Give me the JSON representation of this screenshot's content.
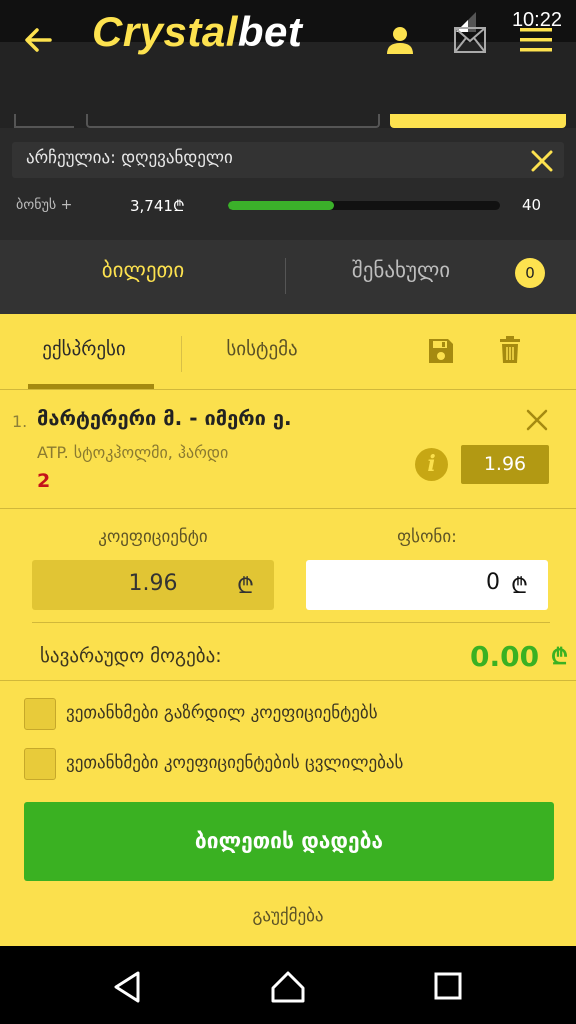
{
  "status_bar": {
    "time": "10:22"
  },
  "header": {
    "logo_part1": "Crystal",
    "logo_part2": "bet"
  },
  "filter": {
    "text": "არჩეულია:  დღევანდელი"
  },
  "bonus": {
    "label": "ბონუს +",
    "amount": "3,741₾",
    "target": "40",
    "progress_fraction": 0.39
  },
  "tabs": {
    "ticket": "ბილეთი",
    "saved": "შენახული",
    "saved_count": "0"
  },
  "slip": {
    "type_tabs": {
      "express": "ექსპრესი",
      "system": "სისტემა"
    },
    "event": {
      "index": "1.",
      "title": "მარტერერი მ. - იმერი ე.",
      "subtitle": "ATP. სტოკჰოლმი, ჰარდი",
      "selection": "2",
      "odds": "1.96",
      "info_symbol": "i"
    },
    "coef_label": "კოეფიციენტი",
    "stake_label": "ფსონი:",
    "coef_value": "1.96",
    "stake_value": "0",
    "currency": "₾",
    "win_label": "სავარაუდო მოგება:",
    "win_value": "0.00",
    "accept_higher_label": "ვეთანხმები გაზრდილ კოეფიციენტებს",
    "accept_change_label": "ვეთანხმები კოეფიციენტების ცვლილებას",
    "place_bet_label": "ბილეთის დადება",
    "cancel_label": "გაუქმება"
  },
  "colors": {
    "brand_yellow": "#fde24f",
    "win_green": "#3ab122",
    "selection_red": "#c4121a"
  }
}
